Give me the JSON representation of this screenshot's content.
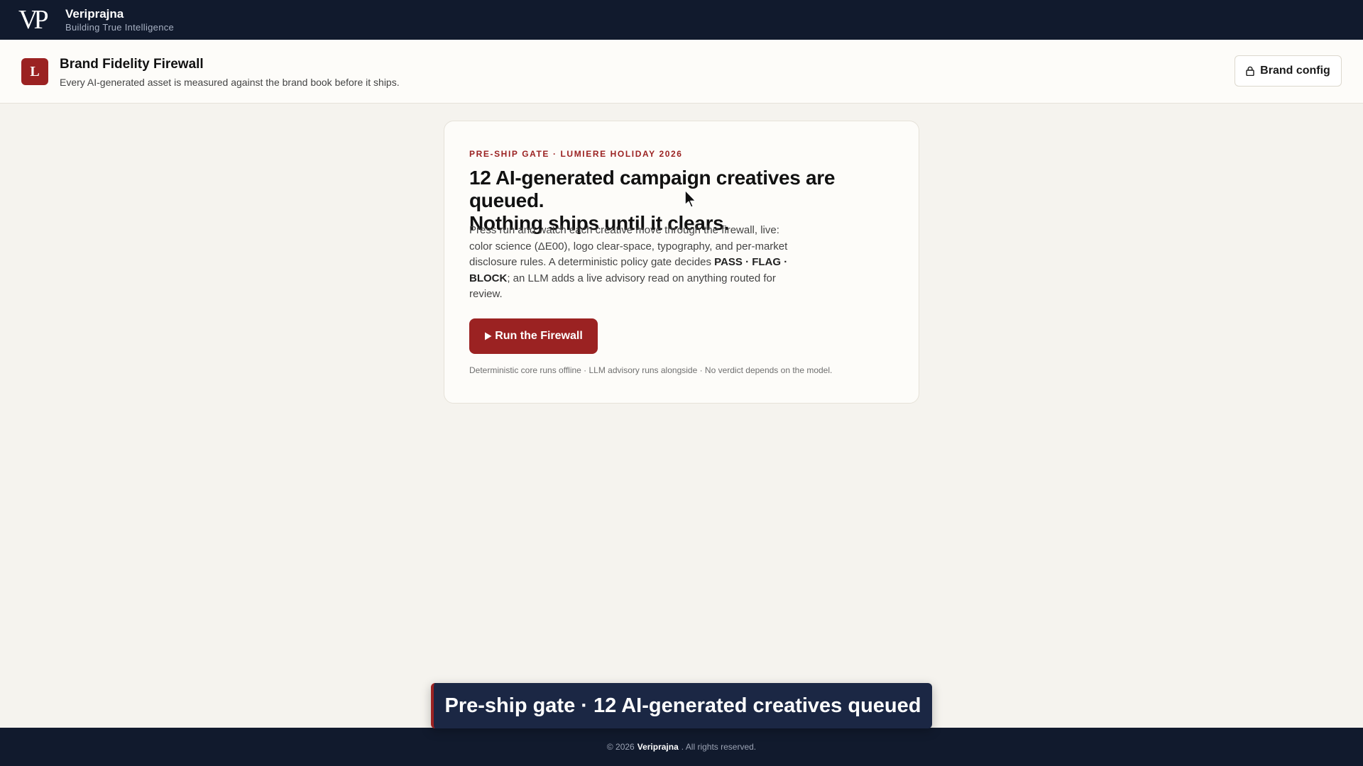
{
  "topbar": {
    "logo": "VP",
    "brand_name": "Veriprajna",
    "tagline": "Building True Intelligence"
  },
  "header": {
    "app_icon_letter": "L",
    "title": "Brand Fidelity Firewall",
    "subtitle": "Every AI-generated asset is measured against the brand book before it ships.",
    "config_button": "Brand config",
    "config_icon": "lock-icon"
  },
  "card": {
    "eyebrow": "PRE-SHIP GATE · LUMIERE HOLIDAY 2026",
    "headline_line1": "12 AI-generated campaign creatives are queued.",
    "headline_line2": "Nothing ships until it clears.",
    "desc_part1": "Press run and watch each creative move through the firewall, live: color science (ΔE00), logo clear-space, typography, and per-market disclosure rules. A deterministic policy gate decides ",
    "desc_bold": "PASS · FLAG · BLOCK",
    "desc_part2": "; an LLM adds a live advisory read on anything routed for review.",
    "run_button_icon": "play-icon",
    "run_button_label": "Run the Firewall",
    "note": "Deterministic core runs offline · LLM advisory runs alongside · No verdict depends on the model."
  },
  "toast": {
    "text": "Pre-ship gate · 12 AI-generated creatives queued"
  },
  "footer": {
    "prefix": "© 2026",
    "brand": "Veriprajna",
    "suffix": ". All rights reserved."
  },
  "colors": {
    "navy": "#111a2d",
    "accent": "#9b2222",
    "background": "#f5f3ee",
    "toast": "#1b2744"
  }
}
